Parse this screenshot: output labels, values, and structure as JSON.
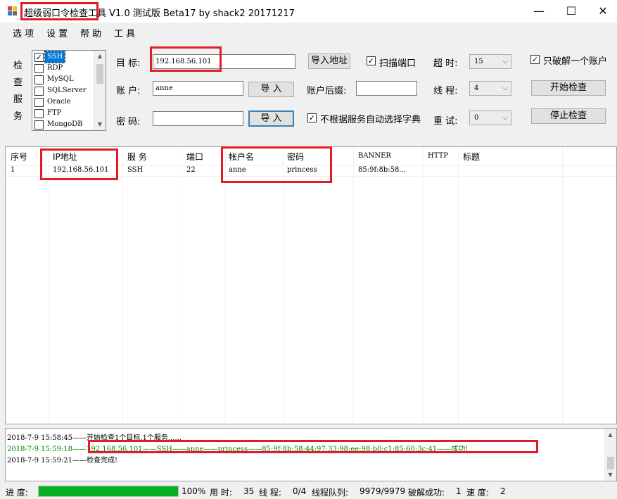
{
  "window": {
    "title_hl": "超级弱口令检查工具",
    "title_rest": " V1.0 测试版 Beta17 by shack2 20171217",
    "minimize": "—",
    "maximize": "☐",
    "close": "✕"
  },
  "menu": [
    "选 项",
    "设 置",
    "帮 助",
    "工 具"
  ],
  "services_label": [
    "检",
    "查",
    "服",
    "务"
  ],
  "services": [
    {
      "name": "SSH",
      "checked": true,
      "selected": true
    },
    {
      "name": "RDP",
      "checked": false
    },
    {
      "name": "MySQL",
      "checked": false
    },
    {
      "name": "SQLServer",
      "checked": false
    },
    {
      "name": "Oracle",
      "checked": false
    },
    {
      "name": "FTP",
      "checked": false
    },
    {
      "name": "MongoDB",
      "checked": false
    }
  ],
  "form": {
    "target_label": "目 标:",
    "target_value": "192.168.56.101",
    "import_addr": "导入地址",
    "scan_port": "扫描端口",
    "timeout_label": "超 时:",
    "timeout_value": "15",
    "only_one": "只破解一个账户",
    "account_label": "账 户:",
    "account_value": "anne",
    "import1": "导 入",
    "suffix_label": "账户后缀:",
    "suffix_value": "",
    "threads_label": "线 程:",
    "threads_value": "4",
    "start": "开始检查",
    "password_label": "密 码:",
    "password_value": "",
    "import2": "导 入",
    "no_auto_dict": "不根据服务自动选择字典",
    "retry_label": "重 试:",
    "retry_value": "0",
    "stop": "停止检查"
  },
  "grid": {
    "headers": [
      "序号",
      "IP地址",
      "服 务",
      "端口",
      "帐户名",
      "密码",
      "BANNER",
      "HTTP",
      "标题"
    ],
    "rows": [
      [
        "1",
        "192.168.56.101",
        "SSH",
        "22",
        "anne",
        "princess",
        "85:9f:8b:58...",
        "",
        ""
      ]
    ]
  },
  "log": [
    {
      "text": "2018-7-9 15:58:45——开始检查1个目标,1个服务......",
      "color": "#000000"
    },
    {
      "text": "2018-7-9 15:59:18——192.168.56.101——SSH——anne——princess——85:9f:8b:58:44:97:33:98:ee:98:b0:c1:85:60:3c:41——成功!",
      "color": "#008000"
    },
    {
      "text": "2018-7-9 15:59:21——检查完成!",
      "color": "#000000"
    }
  ],
  "status": {
    "progress_label": "进 度:",
    "progress_fraction": 1.0,
    "progress_pct": "100%",
    "time_label": "用 时:",
    "time_value": "35",
    "threads_label": "线 程:",
    "threads_value": "0/4",
    "queue_label": "线程队列:",
    "queue_value": "9979/9979",
    "success_label": "破解成功:",
    "success_value": "1",
    "speed_label": "速 度:",
    "speed_value": "2"
  },
  "colors": {
    "highlight": "#e21b25",
    "success_log": "#008000",
    "progress": "#06b025",
    "selection": "#0078d7"
  }
}
